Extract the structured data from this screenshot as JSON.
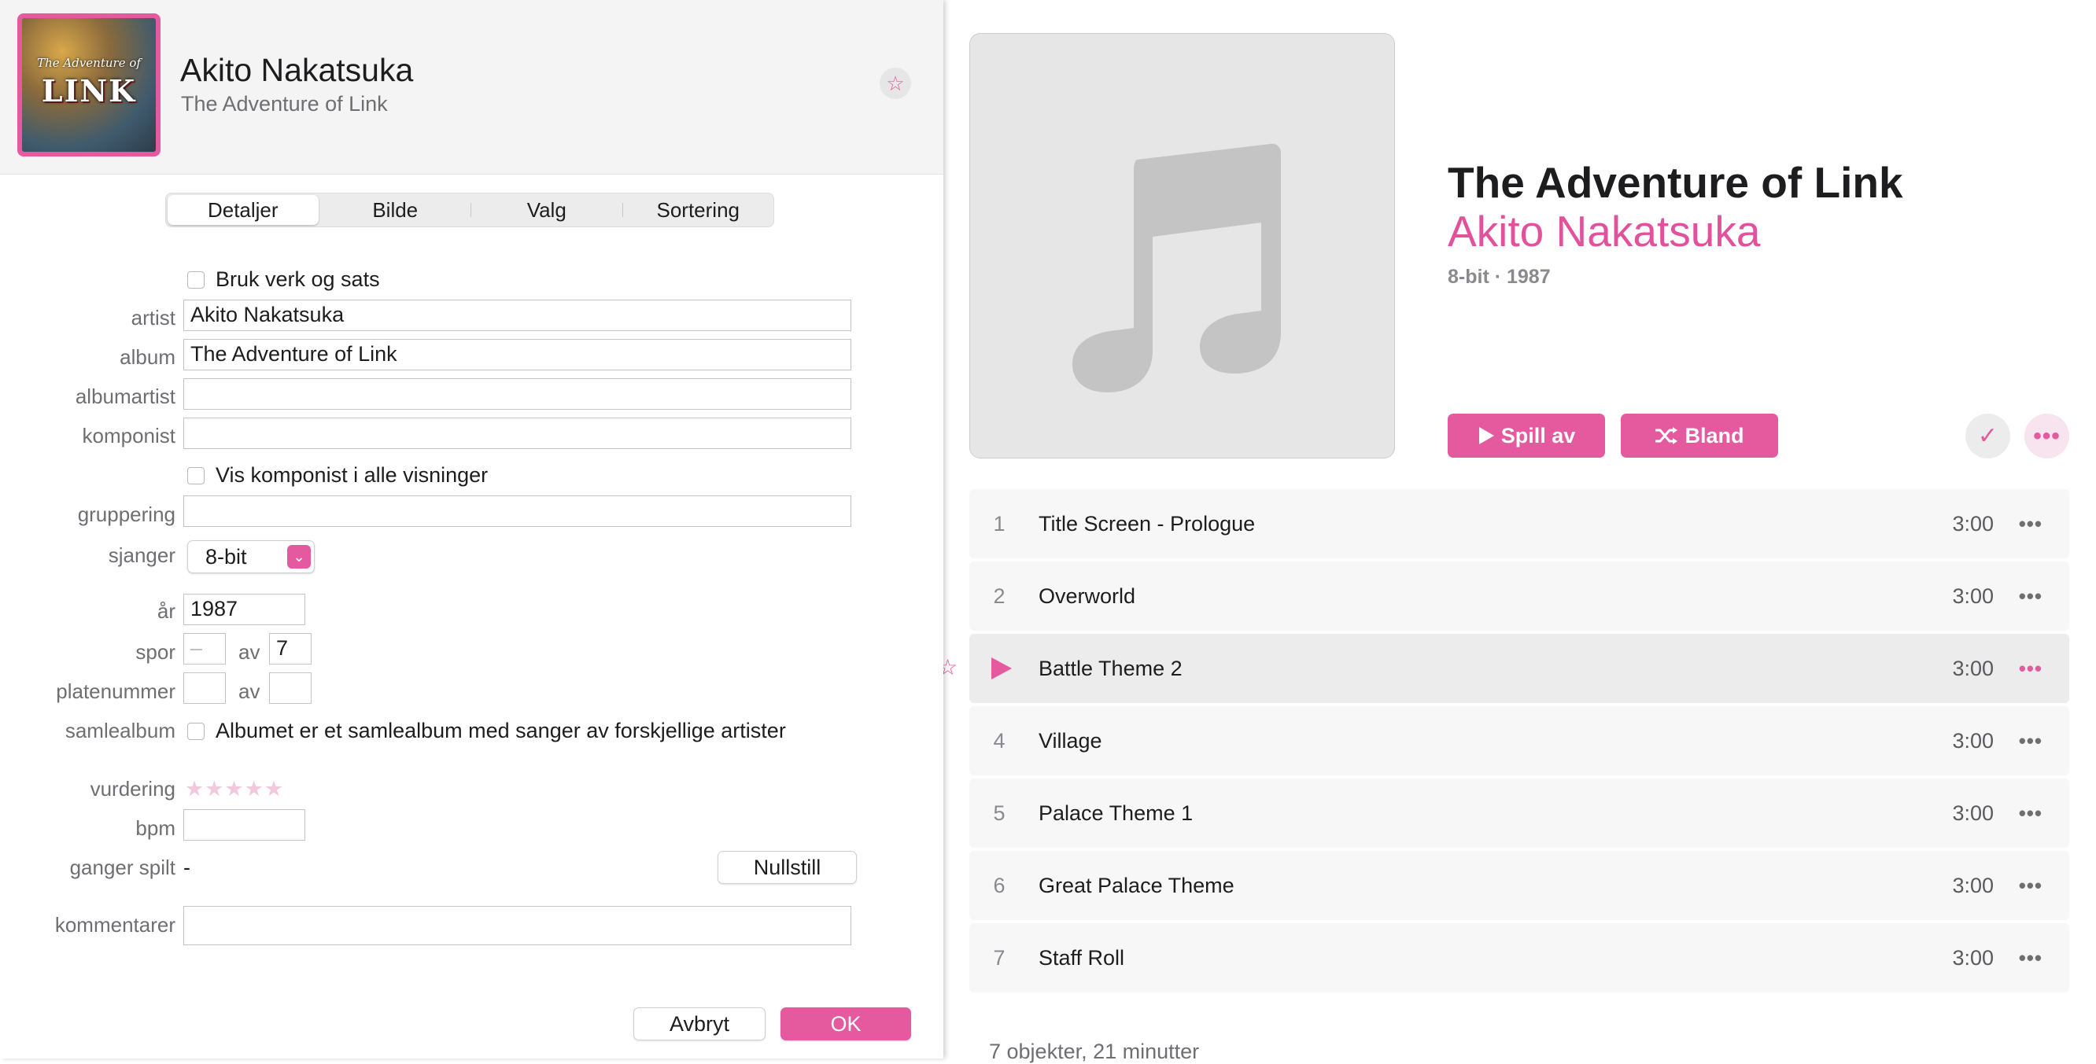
{
  "dialog": {
    "header": {
      "artist": "Akito Nakatsuka",
      "album": "The Adventure of Link",
      "cover_text": "LINK",
      "cover_subtext": "The Adventure of"
    },
    "tabs": [
      "Detaljer",
      "Bilde",
      "Valg",
      "Sortering"
    ],
    "active_tab": "Detaljer",
    "form": {
      "use_work_label": "Bruk verk og sats",
      "artist_label": "artist",
      "artist_value": "Akito Nakatsuka",
      "album_label": "album",
      "album_value": "The Adventure of Link",
      "album_artist_label": "albumartist",
      "album_artist_value": "",
      "composer_label": "komponist",
      "composer_value": "",
      "show_composer_label": "Vis komponist i alle visninger",
      "grouping_label": "gruppering",
      "grouping_value": "",
      "genre_label": "sjanger",
      "genre_value": "8-bit",
      "year_label": "år",
      "year_value": "1987",
      "track_label": "spor",
      "track_number_placeholder": "–",
      "of_label": "av",
      "track_total": "7",
      "disc_label": "platenummer",
      "disc_number": "",
      "disc_total": "",
      "compilation_label": "samlealbum",
      "compilation_text": "Albumet er et samlealbum med sanger av forskjellige artister",
      "rating_label": "vurdering",
      "rating_stars": "★★★★★",
      "bpm_label": "bpm",
      "bpm_value": "",
      "plays_label": "ganger spilt",
      "plays_value": "-",
      "reset_label": "Nullstill",
      "comments_label": "kommentarer",
      "comments_value": ""
    },
    "buttons": {
      "cancel": "Avbryt",
      "ok": "OK"
    }
  },
  "album": {
    "title": "The Adventure of Link",
    "artist": "Akito Nakatsuka",
    "meta": "8-bit · 1987",
    "play_label": "Spill av",
    "shuffle_label": "Bland",
    "added_icon": "✓",
    "more_icon": "•••",
    "tracks": [
      {
        "num": "1",
        "title": "Title Screen - Prologue",
        "time": "3:00"
      },
      {
        "num": "2",
        "title": "Overworld",
        "time": "3:00"
      },
      {
        "num": "3",
        "title": "Battle Theme 2",
        "time": "3:00",
        "playing": true
      },
      {
        "num": "4",
        "title": "Village",
        "time": "3:00"
      },
      {
        "num": "5",
        "title": "Palace Theme 1",
        "time": "3:00"
      },
      {
        "num": "6",
        "title": "Great Palace Theme",
        "time": "3:00"
      },
      {
        "num": "7",
        "title": "Staff Roll",
        "time": "3:00"
      }
    ],
    "row_more_icon": "•••",
    "summary": "7 objekter, 21 minutter"
  },
  "colors": {
    "accent": "#e55a9f",
    "accent_text": "#e2519c"
  }
}
